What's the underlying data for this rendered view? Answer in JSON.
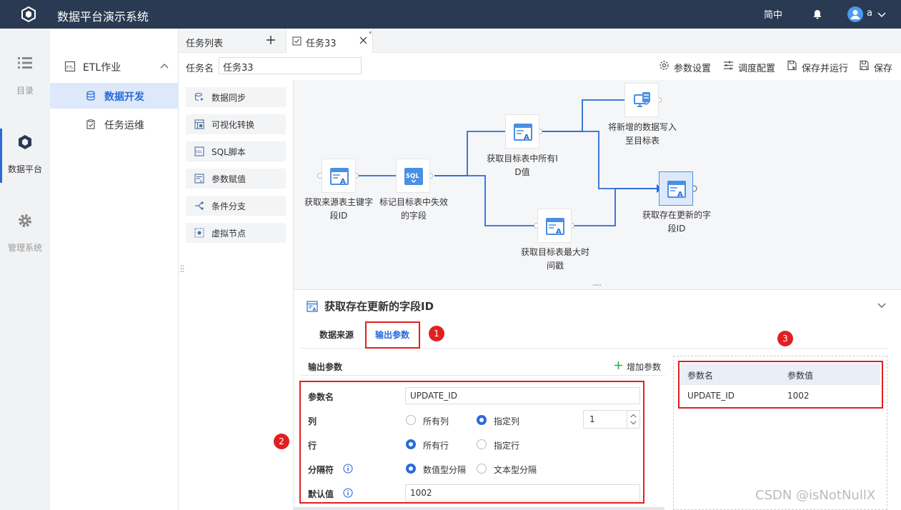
{
  "header": {
    "app_title": "数据平台演示系统",
    "lang": "简中",
    "user": "a"
  },
  "leftnav": [
    {
      "label": "目录",
      "icon": "list-icon"
    },
    {
      "label": "数据平台",
      "icon": "cube-icon",
      "active": true
    },
    {
      "label": "管理系统",
      "icon": "gear-icon"
    }
  ],
  "sidebar": {
    "group": "ETL作业",
    "items": [
      {
        "label": "数据开发",
        "active": true
      },
      {
        "label": "任务运维"
      }
    ]
  },
  "tabs": {
    "list_label": "任务列表",
    "task_label": "任务33",
    "modified": "*"
  },
  "toolbar": {
    "task_name_label": "任务名",
    "task_name": "任务33",
    "params": "参数设置",
    "schedule": "调度配置",
    "save_run": "保存并运行",
    "save": "保存"
  },
  "components": [
    "数据同步",
    "可视化转换",
    "SQL脚本",
    "参数赋值",
    "条件分支",
    "虚拟节点"
  ],
  "canvas": {
    "nodes": [
      {
        "id": "n1",
        "label": [
          "获取来源表主键字",
          "段ID"
        ]
      },
      {
        "id": "n2",
        "label": [
          "标记目标表中失效",
          "的字段"
        ]
      },
      {
        "id": "n3",
        "label": [
          "获取目标表中所有I",
          "D值"
        ]
      },
      {
        "id": "n4",
        "label": [
          "将新增的数据写入",
          "至目标表"
        ]
      },
      {
        "id": "n5",
        "label": [
          "获取存在更新的字",
          "段ID"
        ],
        "selected": true
      },
      {
        "id": "n6",
        "label": [
          "获取目标表最大时",
          "间戳"
        ]
      }
    ]
  },
  "props": {
    "title": "获取存在更新的字段ID",
    "tabs": [
      "数据来源",
      "输出参数"
    ],
    "active_tab": "输出参数",
    "section_title": "输出参数",
    "add_param": "增加参数",
    "fields": {
      "name_label": "参数名",
      "name_value": "UPDATE_ID",
      "col_label": "列",
      "col_opt1": "所有列",
      "col_opt2": "指定列",
      "col_value": "1",
      "row_label": "行",
      "row_opt1": "所有行",
      "row_opt2": "指定行",
      "sep_label": "分隔符",
      "sep_opt1": "数值型分隔",
      "sep_opt2": "文本型分隔",
      "default_label": "默认值",
      "default_value": "1002"
    },
    "table": {
      "headers": [
        "参数名",
        "参数值"
      ],
      "rows": [
        [
          "UPDATE_ID",
          "1002"
        ]
      ]
    }
  },
  "annotations": [
    "1",
    "2",
    "3"
  ],
  "watermark": "CSDN @isNotNullX",
  "colors": {
    "topbar": "#2a3a52",
    "accent": "#2a6bd8",
    "annotation": "#e02020"
  }
}
